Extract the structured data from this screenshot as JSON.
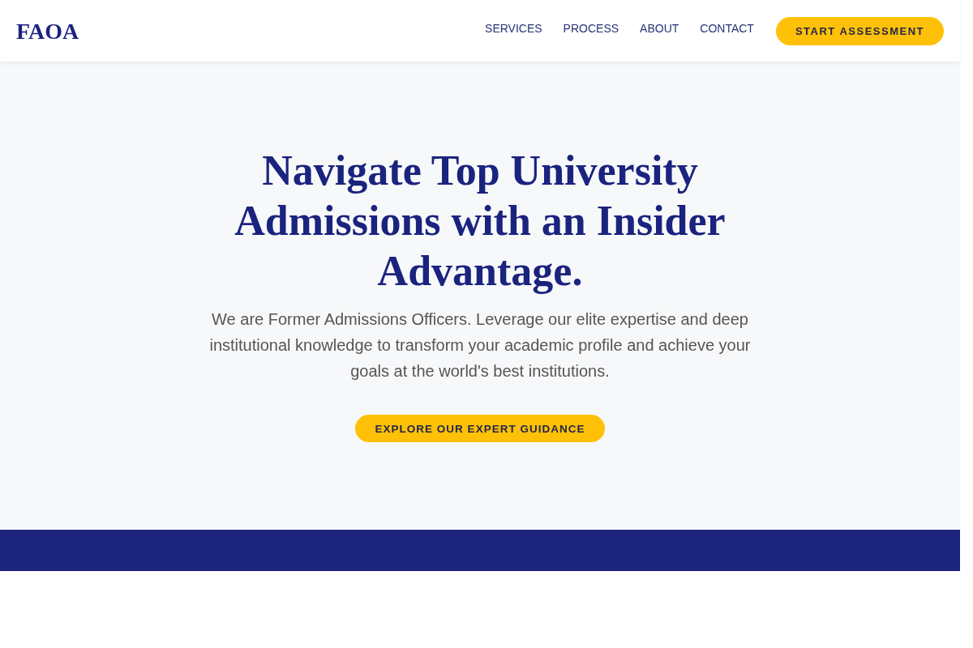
{
  "header": {
    "logo": "FAOA",
    "nav_links": [
      "SERVICES",
      "PROCESS",
      "ABOUT",
      "CONTACT"
    ],
    "cta_button": "START ASSESSMENT"
  },
  "hero": {
    "title": "Navigate Top University Admissions with an Insider Advantage.",
    "description": "We are Former Admissions Officers. Leverage our elite expertise and deep institutional knowledge to transform your academic profile and achieve your goals at the world's best institutions.",
    "button": "EXPLORE OUR EXPERT GUIDANCE"
  }
}
